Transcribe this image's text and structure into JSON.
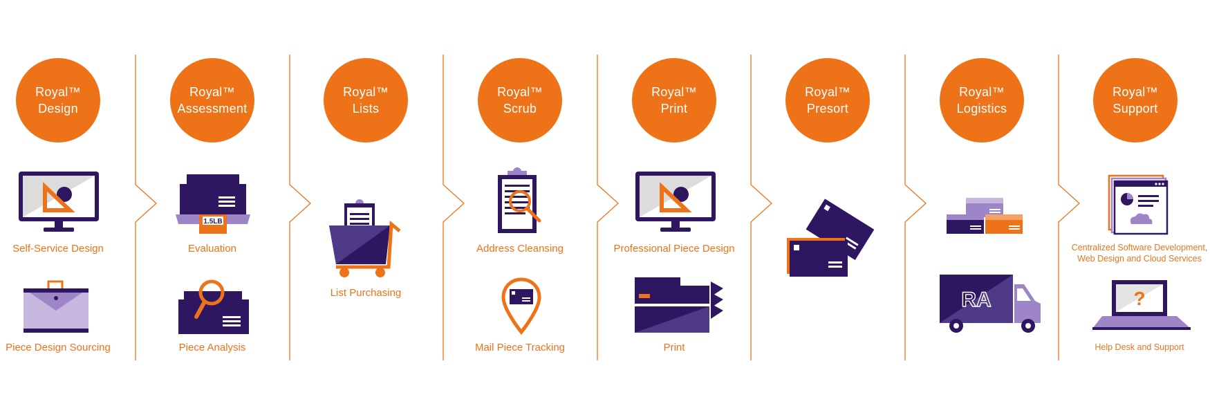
{
  "colors": {
    "orange": "#ee7318",
    "purple_dark": "#2e1660",
    "purple_mid": "#4f3a87",
    "purple_light": "#9d85c7",
    "purple_pale": "#c6b7df",
    "white": "#ffffff"
  },
  "columns": [
    {
      "circle_text": "Royal™\nDesign",
      "items": [
        {
          "label": "Self-Service Design",
          "icon": "monitor-design-icon"
        },
        {
          "label": "Piece Design Sourcing",
          "icon": "envelope-portfolio-icon"
        }
      ]
    },
    {
      "circle_text": "Royal™\nAssessment",
      "items": [
        {
          "label": "Evaluation",
          "icon": "scale-weighing-icon",
          "weight_tag": "1.5LB"
        },
        {
          "label": "Piece Analysis",
          "icon": "box-magnifier-icon"
        }
      ]
    },
    {
      "circle_text": "Royal™\nLists",
      "items": [
        {
          "label": "List Purchasing",
          "icon": "shopping-cart-icon"
        }
      ]
    },
    {
      "circle_text": "Royal™\nScrub",
      "items": [
        {
          "label": "Address Cleansing",
          "icon": "clipboard-magnifier-icon"
        },
        {
          "label": "Mail Piece Tracking",
          "icon": "location-pin-mail-icon"
        }
      ]
    },
    {
      "circle_text": "Royal™\nPrint",
      "items": [
        {
          "label": "Professional Piece Design",
          "icon": "monitor-design-icon"
        },
        {
          "label": "Print",
          "icon": "printer-icon"
        }
      ]
    },
    {
      "circle_text": "Royal™\nPresort",
      "items": [
        {
          "label": "",
          "icon": "envelopes-stack-icon"
        }
      ]
    },
    {
      "circle_text": "Royal™\nLogistics",
      "items": [
        {
          "label": "",
          "icon": "packages-stack-icon"
        },
        {
          "label": "",
          "icon": "delivery-truck-icon"
        }
      ]
    },
    {
      "circle_text": "Royal™\nSupport",
      "items": [
        {
          "label": "Centralized Software Development,\nWeb Design and Cloud Services",
          "icon": "browser-windows-cloud-icon"
        },
        {
          "label": "Help Desk and Support",
          "icon": "laptop-question-icon"
        }
      ]
    }
  ]
}
